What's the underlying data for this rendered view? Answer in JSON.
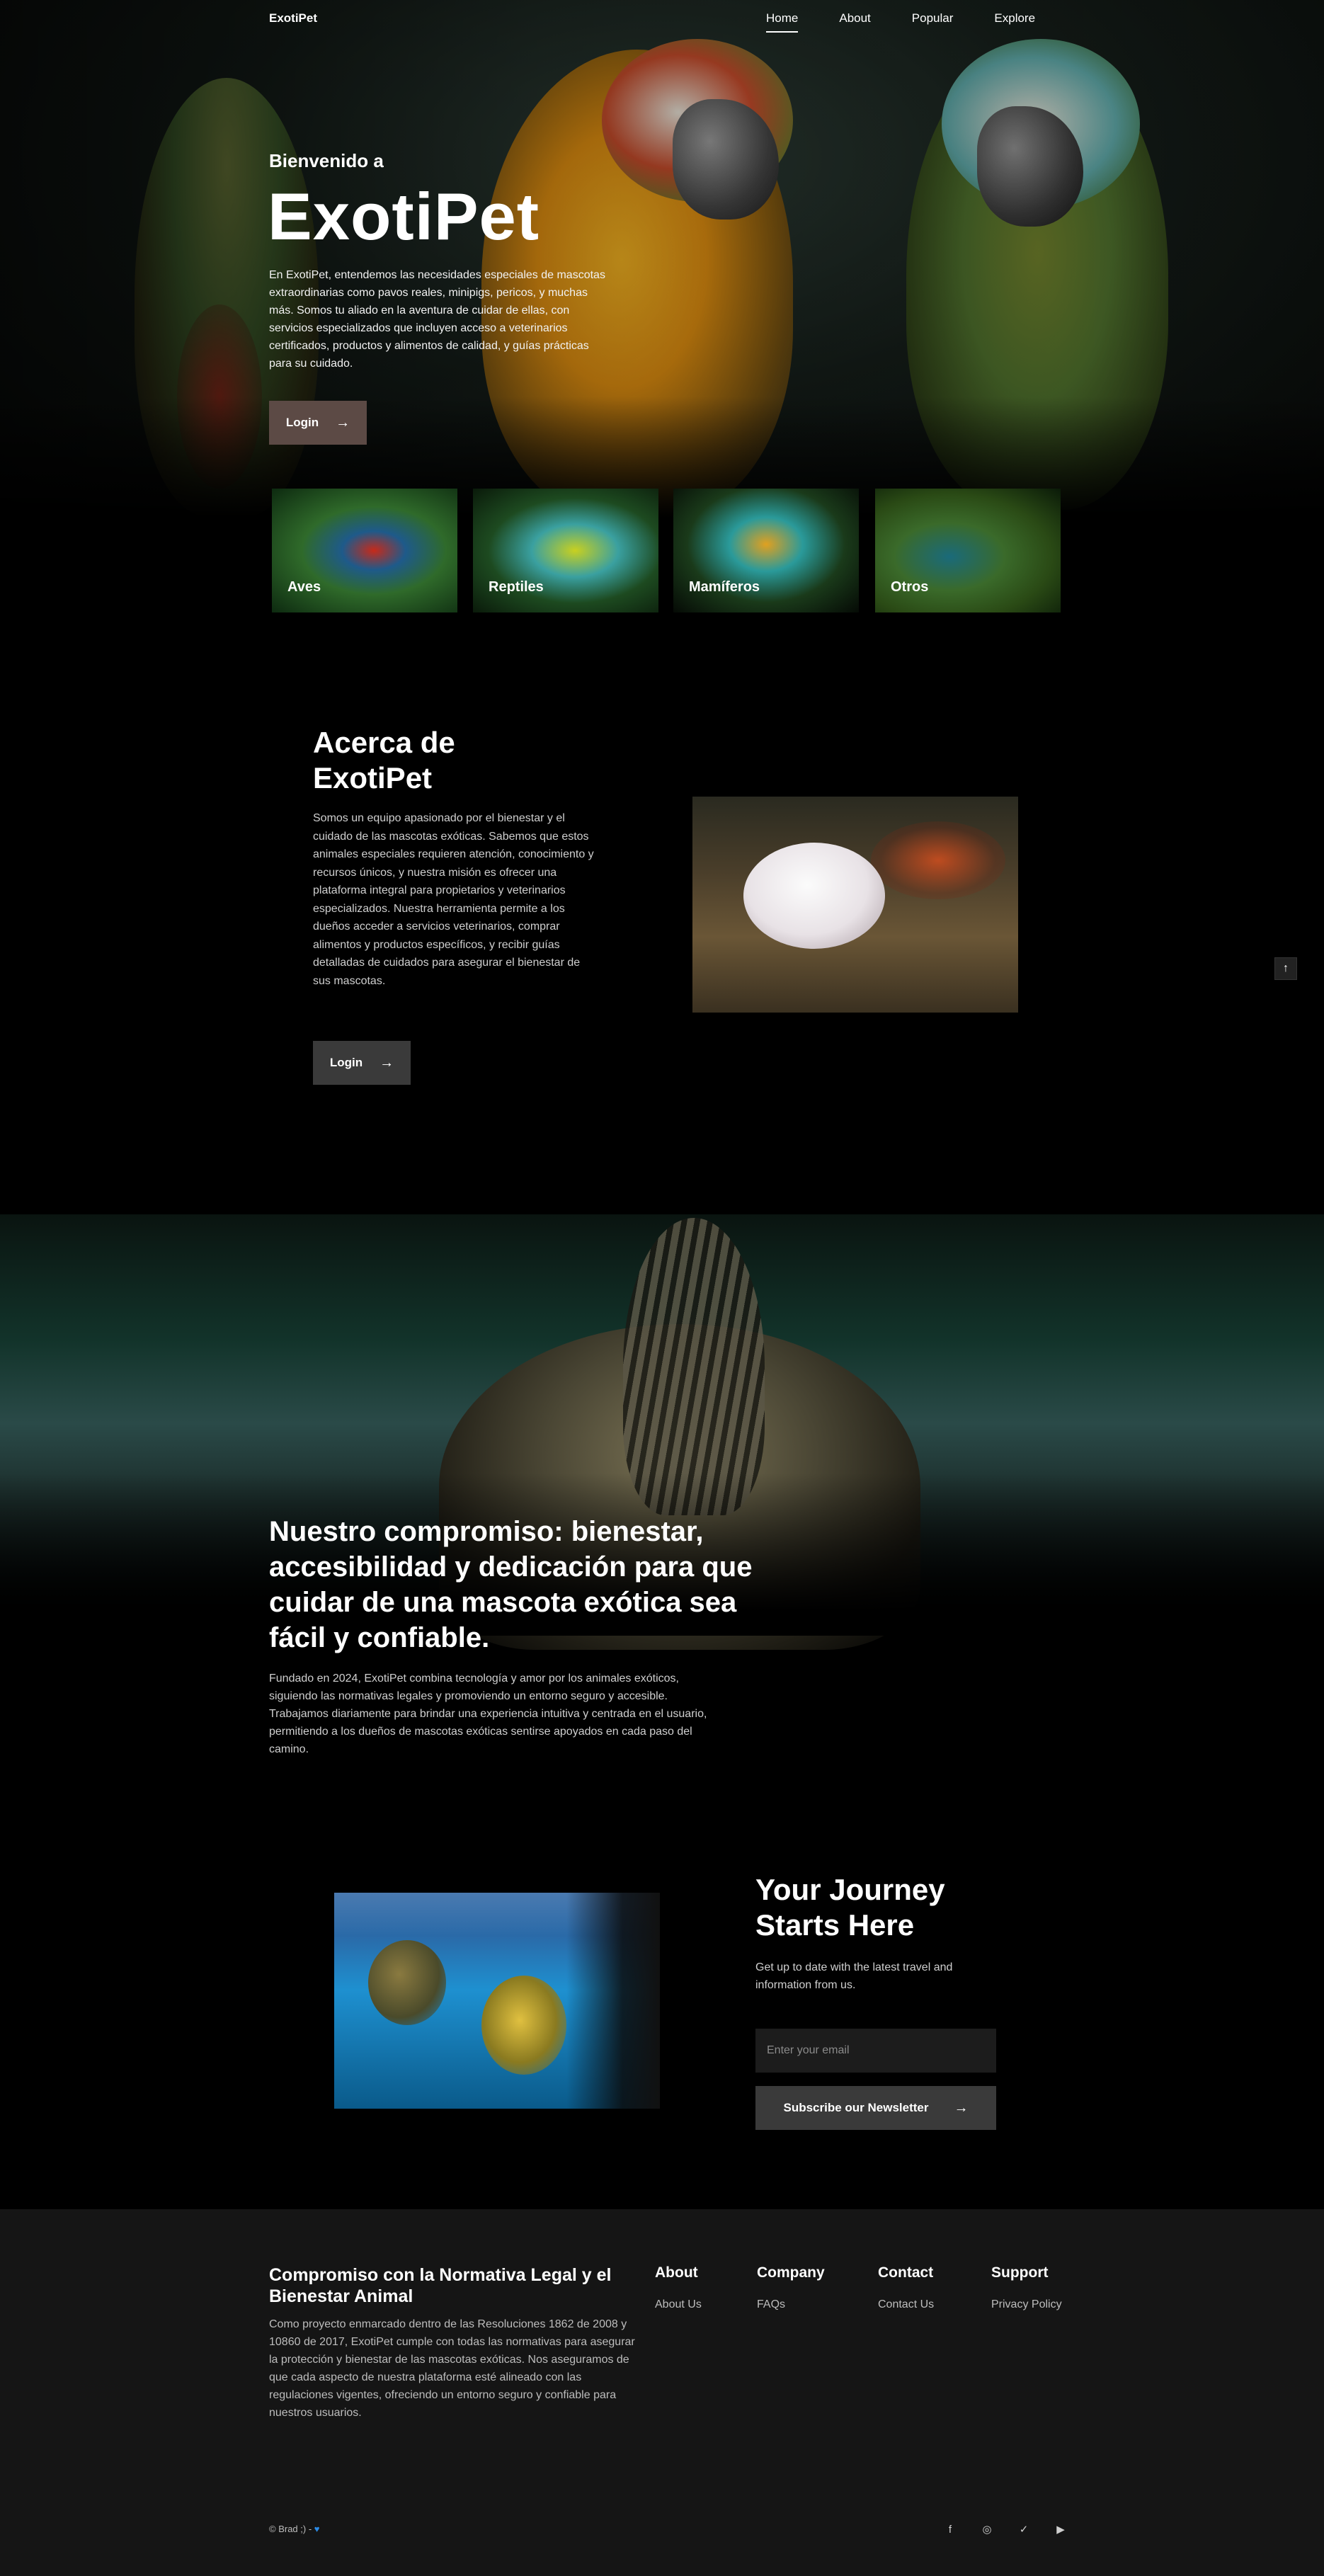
{
  "nav": {
    "brand": "ExotiPet",
    "items": [
      {
        "label": "Home",
        "active": true
      },
      {
        "label": "About",
        "active": false
      },
      {
        "label": "Popular",
        "active": false
      },
      {
        "label": "Explore",
        "active": false
      }
    ]
  },
  "hero": {
    "welcome": "Bienvenido a",
    "title": "ExotiPet",
    "text": "En ExotiPet, entendemos las necesidades especiales de mascotas extraordinarias como pavos reales, minipigs, pericos, y muchas más. Somos tu aliado en la aventura de cuidar de ellas, con servicios especializados que incluyen acceso a veterinarios certificados, productos y alimentos de calidad, y guías prácticas para su cuidado.",
    "button_label": "Login",
    "button_color": "#5c4a45"
  },
  "categories": [
    {
      "label": "Aves"
    },
    {
      "label": "Reptiles"
    },
    {
      "label": "Mamíferos"
    },
    {
      "label": "Otros"
    }
  ],
  "about": {
    "title": "Acerca de ExotiPet",
    "text": "Somos un equipo apasionado por el bienestar y el cuidado de las mascotas exóticas. Sabemos que estos animales especiales requieren atención, conocimiento y recursos únicos, y nuestra misión es ofrecer una plataforma integral para propietarios y veterinarios especializados. Nuestra herramienta permite a los dueños acceder a servicios veterinarios, comprar alimentos y productos específicos, y recibir guías detalladas de cuidados para asegurar el bienestar de sus mascotas.",
    "button_label": "Login"
  },
  "commitment": {
    "title": "Nuestro compromiso: bienestar, accesibilidad y dedicación para que cuidar de una mascota exótica sea fácil y confiable.",
    "text": "Fundado en 2024, ExotiPet combina tecnología y amor por los animales exóticos, siguiendo las normativas legales y promoviendo un entorno seguro y accesible. Trabajamos diariamente para brindar una experiencia intuitiva y centrada en el usuario, permitiendo a los dueños de mascotas exóticas sentirse apoyados en cada paso del camino."
  },
  "newsletter": {
    "title": "Your Journey Starts Here",
    "text": "Get up to date with the latest travel and information from us.",
    "email_placeholder": "Enter your email",
    "button_label": "Subscribe our Newsletter"
  },
  "footer": {
    "title": "Compromiso con la Normativa Legal y el Bienestar Animal",
    "text": "Como proyecto enmarcado dentro de las Resoluciones 1862 de 2008 y 10860 de 2017, ExotiPet cumple con todas las normativas para asegurar la protección y bienestar de las mascotas exóticas. Nos aseguramos de que cada aspecto de nuestra plataforma esté alineado con las regulaciones vigentes, ofreciendo un entorno seguro y confiable para nuestros usuarios.",
    "columns": [
      {
        "heading": "About",
        "link": "About Us"
      },
      {
        "heading": "Company",
        "link": "FAQs"
      },
      {
        "heading": "Contact",
        "link": "Contact Us"
      },
      {
        "heading": "Support",
        "link": "Privacy Policy"
      }
    ],
    "copyright": "© Brad ;) -",
    "heart": "♥",
    "social_icons": [
      "facebook-icon",
      "instagram-icon",
      "twitter-icon",
      "youtube-icon"
    ]
  },
  "icons": {
    "arrow": "→",
    "scroll_top": "↑",
    "facebook": "f",
    "instagram": "◎",
    "twitter": "✓",
    "youtube": "▶"
  },
  "colors": {
    "background": "#000000",
    "footer": "#151515",
    "button": "#3a3a3a",
    "heart": "#2a8ae6"
  }
}
